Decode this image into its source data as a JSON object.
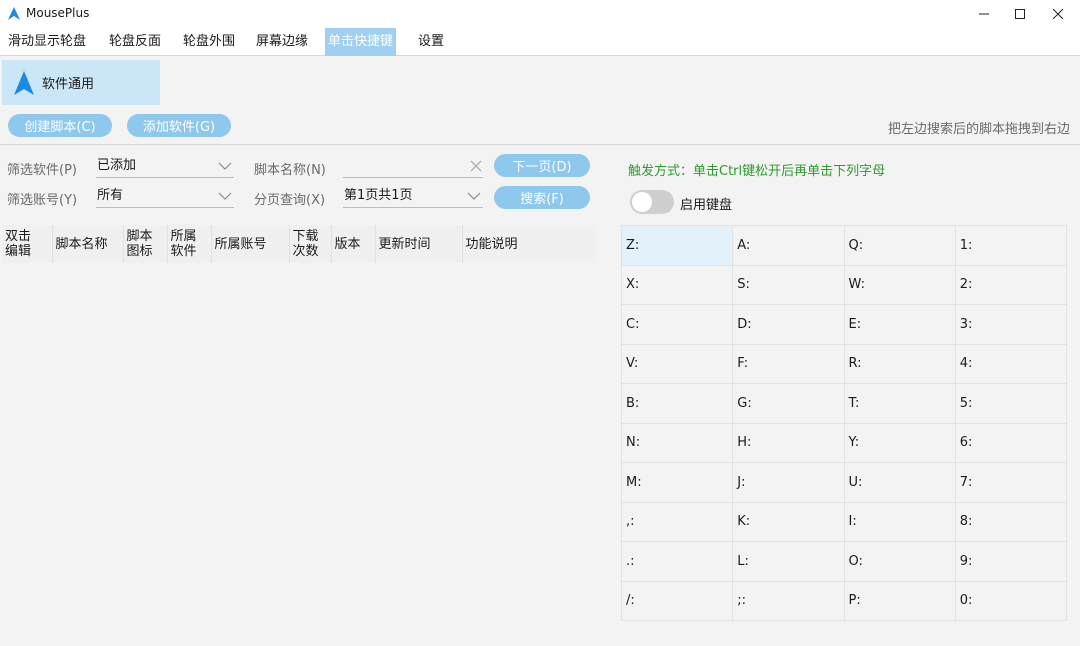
{
  "window": {
    "title": "MousePlus"
  },
  "menu": [
    "滑动显示轮盘",
    "轮盘反面",
    "轮盘外围",
    "屏幕边缘",
    "单击快捷键",
    "设置"
  ],
  "software_tab": {
    "label": "软件通用",
    "icon": "navigation-arrow-icon"
  },
  "buttons": {
    "create_script": "创建脚本(C)",
    "add_software": "添加软件(G)",
    "next_page": "下一页(D)",
    "search": "搜索(F)"
  },
  "hint_right": "把左边搜索后的脚本拖拽到右边",
  "filters": {
    "software_label": "筛选软件(P)",
    "software_value": "已添加",
    "account_label": "筛选账号(Y)",
    "account_value": "所有",
    "script_name_label": "脚本名称(N)",
    "script_name_value": "",
    "page_label": "分页查询(X)",
    "page_value": "第1页共1页"
  },
  "table": {
    "columns": [
      "双击\n编辑",
      "脚本名称",
      "脚本\n图标",
      "所属\n软件",
      "所属账号",
      "下载\n次数",
      "版本",
      "更新时间",
      "功能说明"
    ]
  },
  "trigger_text": "触发方式：单击Ctrl键松开后再单击下列字母",
  "toggle": {
    "label": "启用键盘",
    "on": false
  },
  "keys": [
    "Z:",
    "A:",
    "Q:",
    "1:",
    "X:",
    "S:",
    "W:",
    "2:",
    "C:",
    "D:",
    "E:",
    "3:",
    "V:",
    "F:",
    "R:",
    "4:",
    "B:",
    "G:",
    "T:",
    "5:",
    "N:",
    "H:",
    "Y:",
    "6:",
    "M:",
    "J:",
    "U:",
    "7:",
    ",:",
    "K:",
    "I:",
    "8:",
    ".:",
    "L:",
    "O:",
    "9:",
    "/:",
    ";:",
    "P:",
    "0:"
  ],
  "selected_key": "Z:",
  "colors": {
    "accent": "#8ec8ec",
    "active_tab": "#9fd0f2",
    "trigger_text": "#2e9a2e",
    "logo": "#1e88e5"
  }
}
